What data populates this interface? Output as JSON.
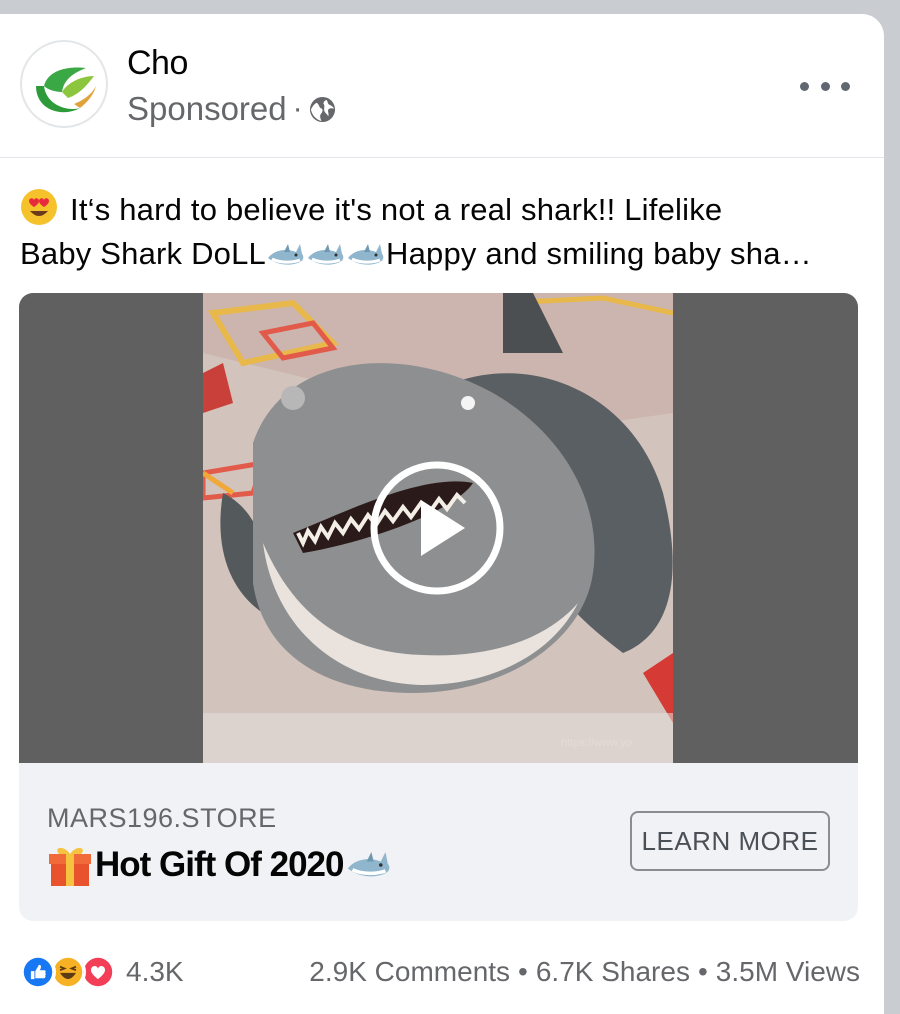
{
  "post": {
    "page_name": "Cho",
    "sponsored_label": "Sponsored",
    "separator": "·",
    "caption_line1": "It‘s hard to believe it's not a real shark!! Lifelike",
    "caption_line2a": "Baby Shark DoLL",
    "caption_line2b": "Happy and smiling baby sha…",
    "icons": [
      "heart-eyes-emoji",
      "shark-emoji",
      "globe-icon",
      "more-options-icon",
      "play-icon",
      "gift-emoji"
    ]
  },
  "media": {
    "watermark": "https://www.yo"
  },
  "link": {
    "domain": "MARS196.STORE",
    "headline": "Hot Gift Of 2020",
    "cta_label": "LEARN MORE"
  },
  "footer": {
    "reaction_count": "4.3K",
    "comments": "2.9K Comments",
    "shares": "6.7K Shares",
    "views": "3.5M Views",
    "bullet": "•",
    "reaction_types": [
      "like",
      "haha",
      "love"
    ]
  },
  "colors": {
    "text_primary": "#050505",
    "text_secondary": "#65676b",
    "like_blue": "#1877f2",
    "love_red": "#f33e58",
    "haha_yellow": "#f7b125",
    "media_bg": "#606060",
    "cta_bg": "#f0f2f5"
  }
}
